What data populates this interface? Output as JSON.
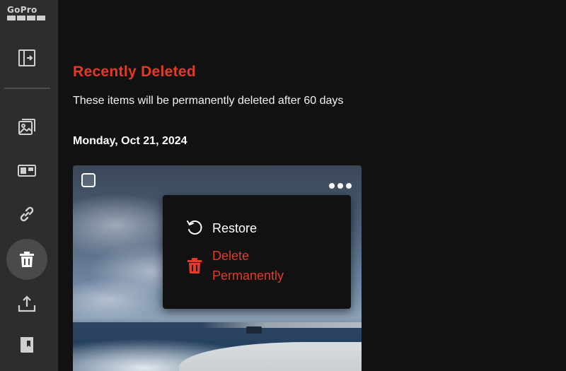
{
  "sidebar": {
    "logo_text": "GoPro",
    "items": [
      {
        "name": "sidebar-toggle",
        "icon": "sidebar-toggle-icon",
        "active": false
      },
      {
        "name": "media-library",
        "icon": "gallery-icon",
        "active": false
      },
      {
        "name": "camera",
        "icon": "camera-icon",
        "active": false
      },
      {
        "name": "links",
        "icon": "link-icon",
        "active": false
      },
      {
        "name": "recently-deleted",
        "icon": "trash-icon",
        "active": true
      },
      {
        "name": "upload",
        "icon": "upload-icon",
        "active": false
      },
      {
        "name": "guides",
        "icon": "book-icon",
        "active": false
      }
    ]
  },
  "main": {
    "title": "Recently Deleted",
    "subtitle": "These items will be permanently deleted after 60 days",
    "date_heading": "Monday, Oct 21, 2024"
  },
  "context_menu": {
    "restore_label": "Restore",
    "delete_label": "Delete Permanently"
  },
  "colors": {
    "accent": "#e33b24",
    "background": "#111111",
    "sidebar": "#2d2d2d",
    "sidebar_active": "#4a4a4a"
  }
}
